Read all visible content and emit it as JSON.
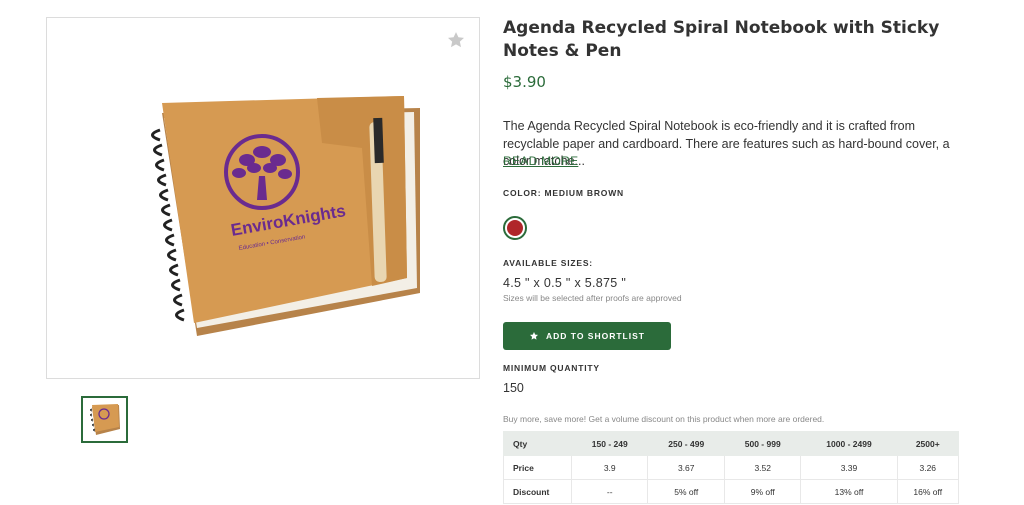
{
  "product": {
    "title": "Agenda Recycled Spiral Notebook with Sticky Notes & Pen",
    "price": "$3.90",
    "description": "The Agenda Recycled Spiral Notebook is eco-friendly and it is crafted from recyclable paper and cardboard. There are features such as hard-bound cover, a color matche...",
    "read_more": "READ MORE",
    "image_logo_text": "EnviroKnights",
    "image_logo_sub": "Education • Conservation"
  },
  "color": {
    "label": "COLOR: MEDIUM BROWN",
    "swatch_hex": "#b0262a"
  },
  "sizes": {
    "label": "AVAILABLE SIZES:",
    "value": "4.5 \" x 0.5 \" x 5.875 \"",
    "note": "Sizes will be selected after proofs are approved"
  },
  "shortlist": {
    "label": "ADD TO SHORTLIST",
    "icon": "star-icon"
  },
  "min_quantity": {
    "label": "MINIMUM QUANTITY",
    "value": "150"
  },
  "pricing": {
    "note": "Buy more, save more! Get a volume discount on this product when more are ordered.",
    "headers": [
      "Qty",
      "150 - 249",
      "250 - 499",
      "500 - 999",
      "1000 - 2499",
      "2500+"
    ],
    "rows": [
      [
        "Price",
        "3.9",
        "3.67",
        "3.52",
        "3.39",
        "3.26"
      ],
      [
        "Discount",
        "--",
        "5% off",
        "9% off",
        "13% off",
        "16% off"
      ]
    ]
  },
  "colors": {
    "brand_green": "#2b6b3a",
    "header_bg": "#e8ece9"
  }
}
